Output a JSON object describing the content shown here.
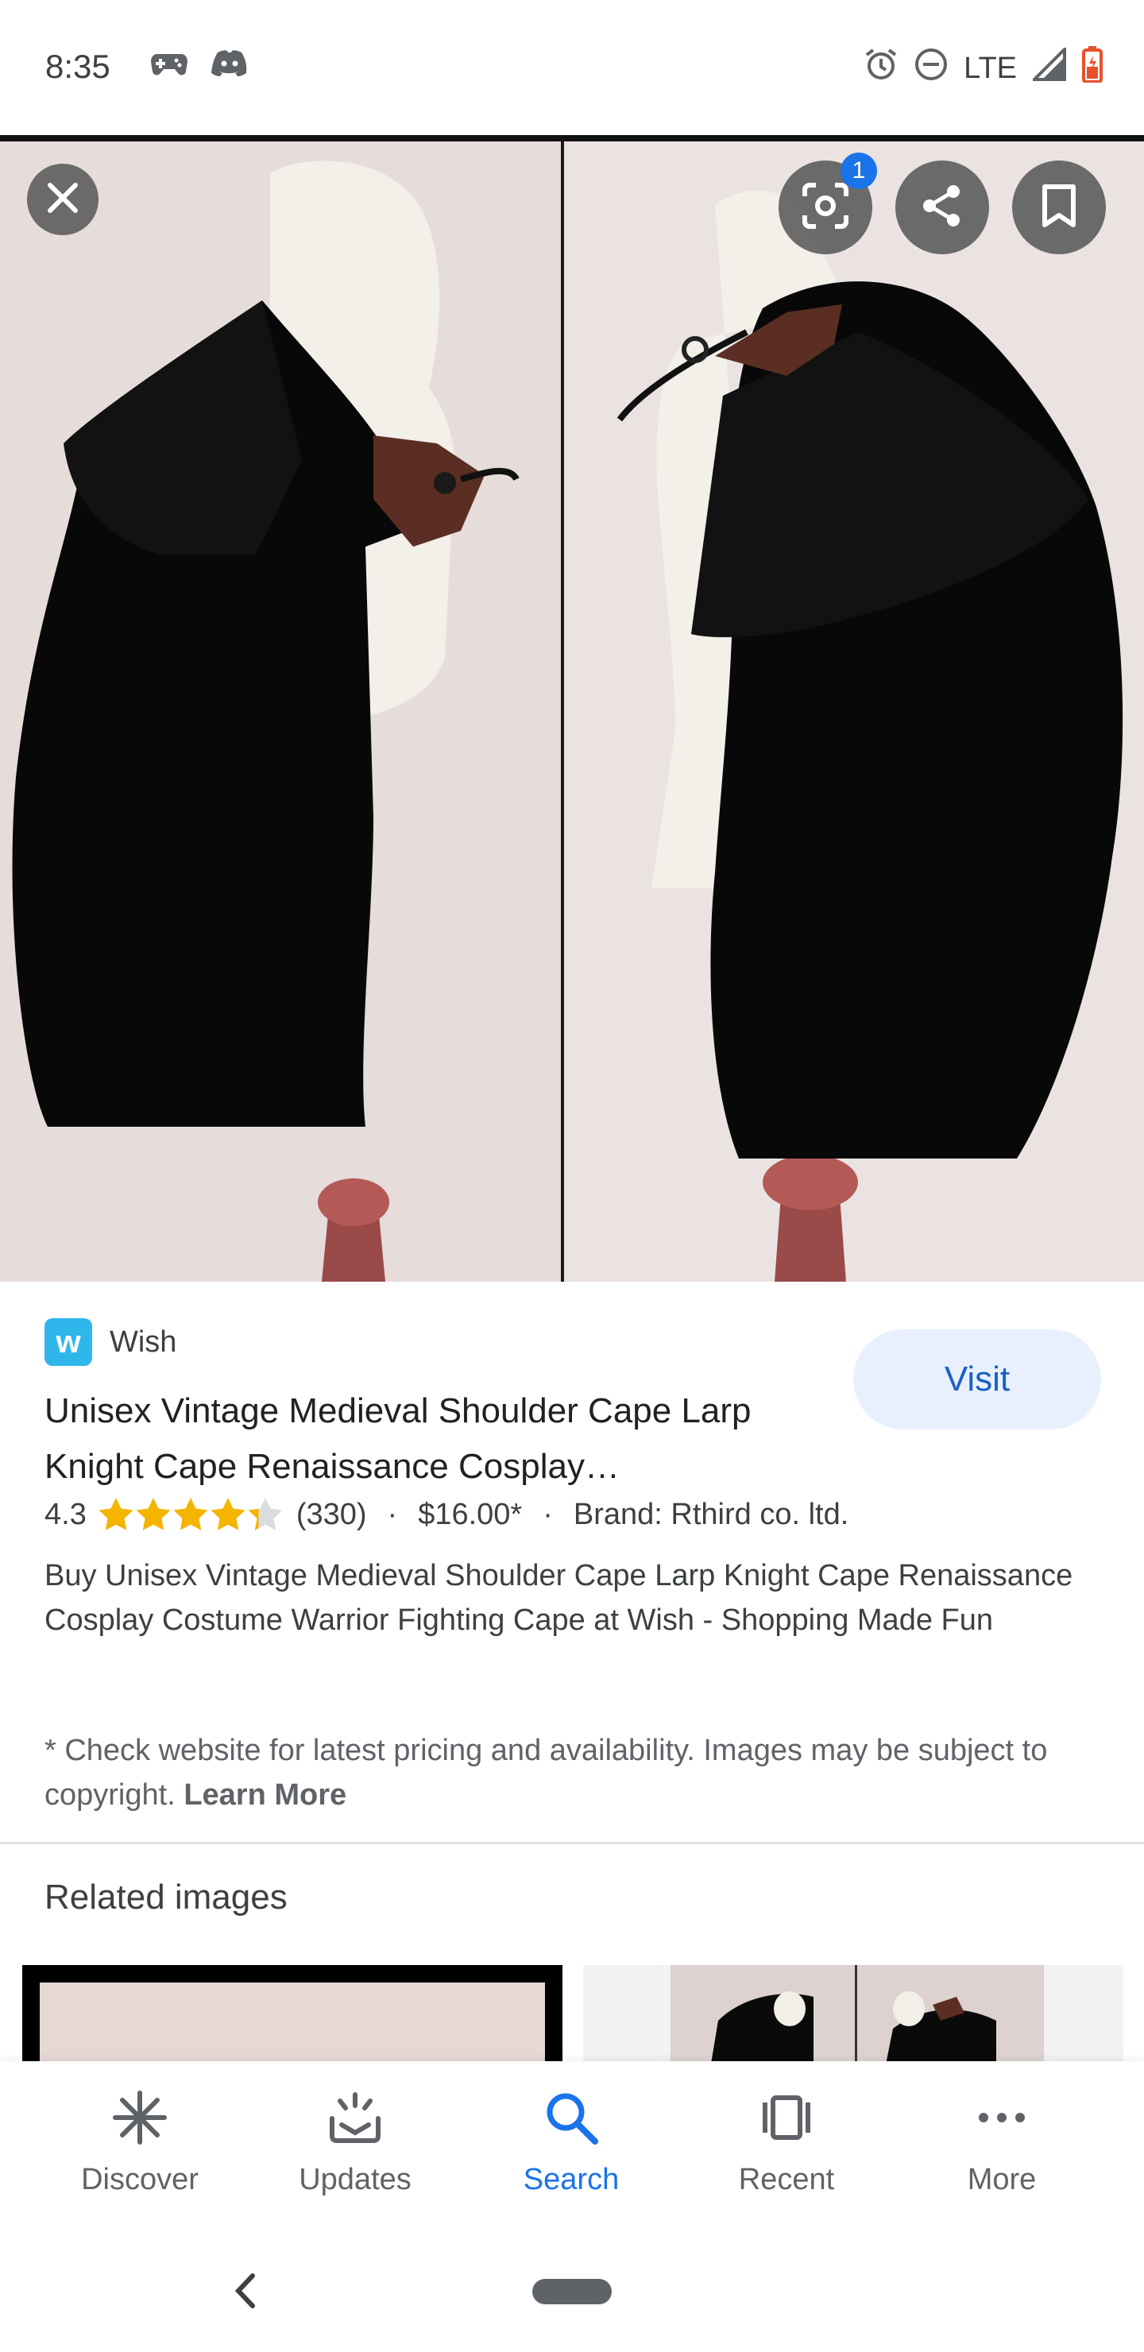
{
  "status_bar": {
    "time": "8:35",
    "left_icons": [
      "game-controller-icon",
      "discord-icon"
    ],
    "right_icons": [
      "alarm-icon",
      "do-not-disturb-icon",
      "signal-icon",
      "battery-icon"
    ],
    "network": "LTE"
  },
  "hero": {
    "lens_badge": "1",
    "buttons": [
      "close-icon",
      "lens-icon",
      "share-icon",
      "bookmark-icon"
    ]
  },
  "result": {
    "source": "Wish",
    "source_logo_letter": "w",
    "visit_label": "Visit",
    "title": "Unisex Vintage Medieval Shoulder Cape Larp Knight Cape Renaissance Cosplay…",
    "rating": "4.3",
    "rating_value": 4.3,
    "reviews": "(330)",
    "price": "$16.00*",
    "brand": "Brand: Rthird co. ltd.",
    "separator": "·",
    "description": "Buy Unisex Vintage Medieval Shoulder Cape Larp Knight Cape Renaissance Cosplay Costume Warrior Fighting Cape at Wish - Shopping Made Fun",
    "disclaimer": "* Check website for latest pricing and availability. Images may be subject to copyright.",
    "learn_more": "Learn More"
  },
  "related": {
    "title": "Related images"
  },
  "bottom_nav": {
    "items": [
      {
        "label": "Discover",
        "icon": "discover-icon"
      },
      {
        "label": "Updates",
        "icon": "updates-icon"
      },
      {
        "label": "Search",
        "icon": "search-icon"
      },
      {
        "label": "Recent",
        "icon": "recent-icon"
      },
      {
        "label": "More",
        "icon": "more-icon"
      }
    ],
    "active": "Search"
  },
  "colors": {
    "accent": "#1a73e8",
    "visit_bg": "#e8f0fe",
    "star": "#f4b400",
    "wish": "#2fb7ec"
  }
}
